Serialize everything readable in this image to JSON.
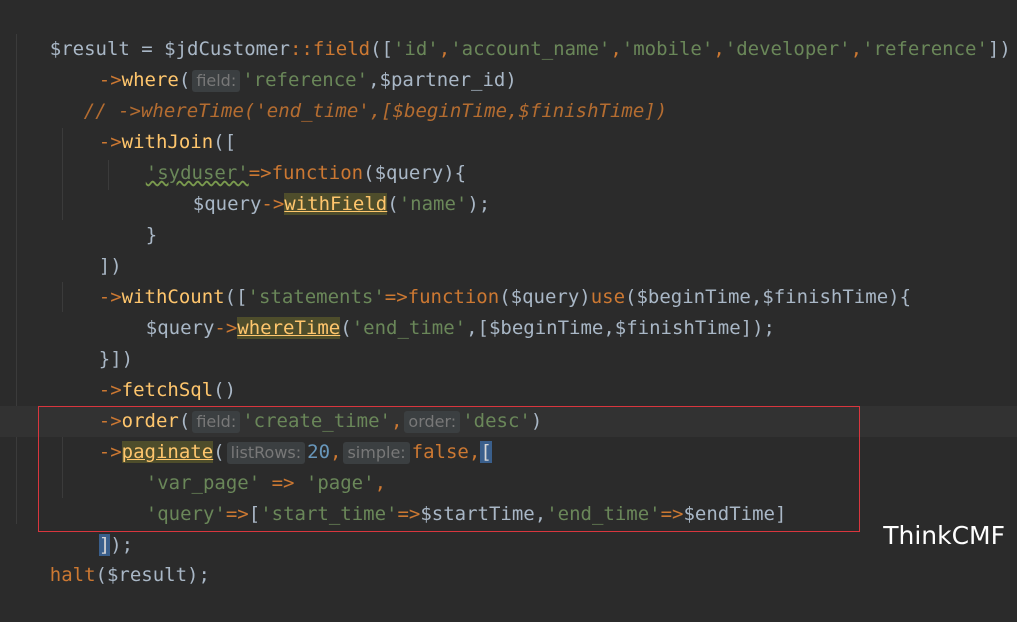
{
  "code": {
    "l1": {
      "a": "$result = $jdCustomer",
      "b": "::",
      "c": "field",
      "d": "([",
      "e": "'id'",
      "f": ",",
      "g": "'account_name'",
      "h": ",",
      "i": "'mobile'",
      "j": ",",
      "k": "'developer'",
      "l": ",",
      "m": "'reference'",
      "n": "])"
    },
    "l2": {
      "a": "->",
      "b": "where",
      "c": "(",
      "hint": "field:",
      "d": "'reference'",
      "e": ",$partner_id)"
    },
    "l3": {
      "text": "// ->whereTime('end_time',[$beginTime,$finishTime])"
    },
    "l4": {
      "a": "->",
      "b": "withJoin",
      "c": "(["
    },
    "l5": {
      "a": "'syduser'",
      "b": "=>",
      "c": "function",
      "d": "($query){"
    },
    "l6": {
      "a": "$query",
      "b": "->",
      "c": "withField",
      "d": "(",
      "e": "'name'",
      "f": ");"
    },
    "l7": {
      "a": "}"
    },
    "l8": {
      "a": "])"
    },
    "l9": {
      "a": "->",
      "b": "withCount",
      "c": "([",
      "d": "'statements'",
      "e": "=>",
      "f": "function",
      "g": "($query)",
      "h": "use",
      "i": "($beginTime,$finishTime){"
    },
    "l10": {
      "a": "$query",
      "b": "->",
      "c": "whereTime",
      "d": "(",
      "e": "'end_time'",
      "f": ",[$beginTime,$finishTime]);"
    },
    "l11": {
      "a": "}])"
    },
    "l12": {
      "a": "->",
      "b": "fetchSql",
      "c": "()"
    },
    "l13": {
      "a": "->",
      "b": "order",
      "c": "(",
      "hint1": "field:",
      "d": "'create_time'",
      "e": ",",
      "hint2": "order:",
      "f": "'desc'",
      "g": ")"
    },
    "l14": {
      "a": "->",
      "b": "paginate",
      "c": "(",
      "hint1": "listRows:",
      "d": "20",
      "e": ",",
      "hint2": "simple:",
      "f": "false",
      "g": ",",
      "h": "["
    },
    "l15": {
      "a": "'var_page'",
      "b": " => ",
      "c": "'page'",
      "d": ","
    },
    "l16": {
      "a": "'query'",
      "b": "=>",
      "c": "[",
      "d": "'start_time'",
      "e": "=>",
      "f": "$startTime,",
      "g": "'end_time'",
      "h": "=>",
      "i": "$endTime]"
    },
    "l17": {
      "a": "]",
      "b": ");"
    },
    "l18": {
      "a": "halt",
      "b": "($result);"
    }
  },
  "watermark": "ThinkCMF",
  "colors": {
    "background": "#2b2b2b",
    "string": "#6a8759",
    "keyword": "#cc7832",
    "method": "#ffc66d",
    "number": "#6897bb",
    "highlight_box": "#d9363e"
  }
}
